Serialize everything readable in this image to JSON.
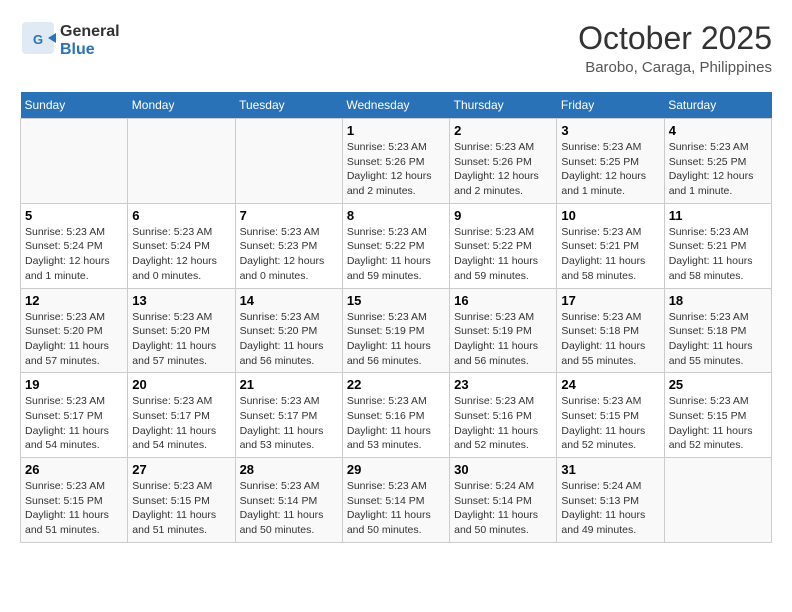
{
  "header": {
    "logo_line1": "General",
    "logo_line2": "Blue",
    "month": "October 2025",
    "location": "Barobo, Caraga, Philippines"
  },
  "weekdays": [
    "Sunday",
    "Monday",
    "Tuesday",
    "Wednesday",
    "Thursday",
    "Friday",
    "Saturday"
  ],
  "weeks": [
    [
      {
        "day": "",
        "info": ""
      },
      {
        "day": "",
        "info": ""
      },
      {
        "day": "",
        "info": ""
      },
      {
        "day": "1",
        "info": "Sunrise: 5:23 AM\nSunset: 5:26 PM\nDaylight: 12 hours and 2 minutes."
      },
      {
        "day": "2",
        "info": "Sunrise: 5:23 AM\nSunset: 5:26 PM\nDaylight: 12 hours and 2 minutes."
      },
      {
        "day": "3",
        "info": "Sunrise: 5:23 AM\nSunset: 5:25 PM\nDaylight: 12 hours and 1 minute."
      },
      {
        "day": "4",
        "info": "Sunrise: 5:23 AM\nSunset: 5:25 PM\nDaylight: 12 hours and 1 minute."
      }
    ],
    [
      {
        "day": "5",
        "info": "Sunrise: 5:23 AM\nSunset: 5:24 PM\nDaylight: 12 hours and 1 minute."
      },
      {
        "day": "6",
        "info": "Sunrise: 5:23 AM\nSunset: 5:24 PM\nDaylight: 12 hours and 0 minutes."
      },
      {
        "day": "7",
        "info": "Sunrise: 5:23 AM\nSunset: 5:23 PM\nDaylight: 12 hours and 0 minutes."
      },
      {
        "day": "8",
        "info": "Sunrise: 5:23 AM\nSunset: 5:22 PM\nDaylight: 11 hours and 59 minutes."
      },
      {
        "day": "9",
        "info": "Sunrise: 5:23 AM\nSunset: 5:22 PM\nDaylight: 11 hours and 59 minutes."
      },
      {
        "day": "10",
        "info": "Sunrise: 5:23 AM\nSunset: 5:21 PM\nDaylight: 11 hours and 58 minutes."
      },
      {
        "day": "11",
        "info": "Sunrise: 5:23 AM\nSunset: 5:21 PM\nDaylight: 11 hours and 58 minutes."
      }
    ],
    [
      {
        "day": "12",
        "info": "Sunrise: 5:23 AM\nSunset: 5:20 PM\nDaylight: 11 hours and 57 minutes."
      },
      {
        "day": "13",
        "info": "Sunrise: 5:23 AM\nSunset: 5:20 PM\nDaylight: 11 hours and 57 minutes."
      },
      {
        "day": "14",
        "info": "Sunrise: 5:23 AM\nSunset: 5:20 PM\nDaylight: 11 hours and 56 minutes."
      },
      {
        "day": "15",
        "info": "Sunrise: 5:23 AM\nSunset: 5:19 PM\nDaylight: 11 hours and 56 minutes."
      },
      {
        "day": "16",
        "info": "Sunrise: 5:23 AM\nSunset: 5:19 PM\nDaylight: 11 hours and 56 minutes."
      },
      {
        "day": "17",
        "info": "Sunrise: 5:23 AM\nSunset: 5:18 PM\nDaylight: 11 hours and 55 minutes."
      },
      {
        "day": "18",
        "info": "Sunrise: 5:23 AM\nSunset: 5:18 PM\nDaylight: 11 hours and 55 minutes."
      }
    ],
    [
      {
        "day": "19",
        "info": "Sunrise: 5:23 AM\nSunset: 5:17 PM\nDaylight: 11 hours and 54 minutes."
      },
      {
        "day": "20",
        "info": "Sunrise: 5:23 AM\nSunset: 5:17 PM\nDaylight: 11 hours and 54 minutes."
      },
      {
        "day": "21",
        "info": "Sunrise: 5:23 AM\nSunset: 5:17 PM\nDaylight: 11 hours and 53 minutes."
      },
      {
        "day": "22",
        "info": "Sunrise: 5:23 AM\nSunset: 5:16 PM\nDaylight: 11 hours and 53 minutes."
      },
      {
        "day": "23",
        "info": "Sunrise: 5:23 AM\nSunset: 5:16 PM\nDaylight: 11 hours and 52 minutes."
      },
      {
        "day": "24",
        "info": "Sunrise: 5:23 AM\nSunset: 5:15 PM\nDaylight: 11 hours and 52 minutes."
      },
      {
        "day": "25",
        "info": "Sunrise: 5:23 AM\nSunset: 5:15 PM\nDaylight: 11 hours and 52 minutes."
      }
    ],
    [
      {
        "day": "26",
        "info": "Sunrise: 5:23 AM\nSunset: 5:15 PM\nDaylight: 11 hours and 51 minutes."
      },
      {
        "day": "27",
        "info": "Sunrise: 5:23 AM\nSunset: 5:15 PM\nDaylight: 11 hours and 51 minutes."
      },
      {
        "day": "28",
        "info": "Sunrise: 5:23 AM\nSunset: 5:14 PM\nDaylight: 11 hours and 50 minutes."
      },
      {
        "day": "29",
        "info": "Sunrise: 5:23 AM\nSunset: 5:14 PM\nDaylight: 11 hours and 50 minutes."
      },
      {
        "day": "30",
        "info": "Sunrise: 5:24 AM\nSunset: 5:14 PM\nDaylight: 11 hours and 50 minutes."
      },
      {
        "day": "31",
        "info": "Sunrise: 5:24 AM\nSunset: 5:13 PM\nDaylight: 11 hours and 49 minutes."
      },
      {
        "day": "",
        "info": ""
      }
    ]
  ]
}
